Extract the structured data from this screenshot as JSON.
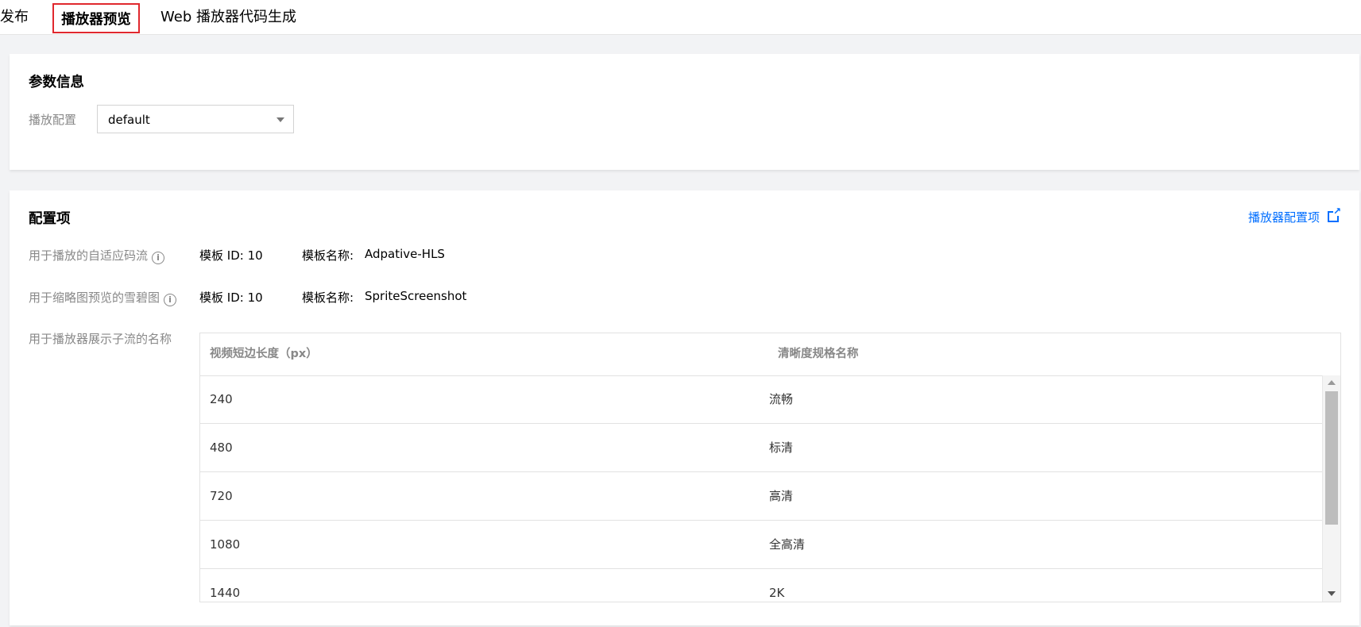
{
  "tabs": {
    "prev_label": "频发布",
    "active_label": "播放器预览",
    "code_label": "Web 播放器代码生成"
  },
  "params": {
    "title": "参数信息",
    "play_config_label": "播放配置",
    "play_config_value": "default"
  },
  "config": {
    "title": "配置项",
    "player_config_link": "播放器配置项",
    "adaptive_label": "用于播放的自适应码流",
    "adaptive_template_id": "模板 ID: 10",
    "adaptive_template_name_label": "模板名称:",
    "adaptive_template_name": "Adpative-HLS",
    "sprite_label": "用于缩略图预览的雪碧图",
    "sprite_template_id": "模板 ID: 10",
    "sprite_template_name_label": "模板名称:",
    "sprite_template_name": "SpriteScreenshot",
    "substream_label": "用于播放器展示子流的名称",
    "table": {
      "columns": [
        "视频短边长度（px）",
        "清晰度规格名称"
      ],
      "rows": [
        [
          "240",
          "流畅"
        ],
        [
          "480",
          "标清"
        ],
        [
          "720",
          "高清"
        ],
        [
          "1080",
          "全高清"
        ],
        [
          "1440",
          "2K"
        ]
      ]
    }
  }
}
